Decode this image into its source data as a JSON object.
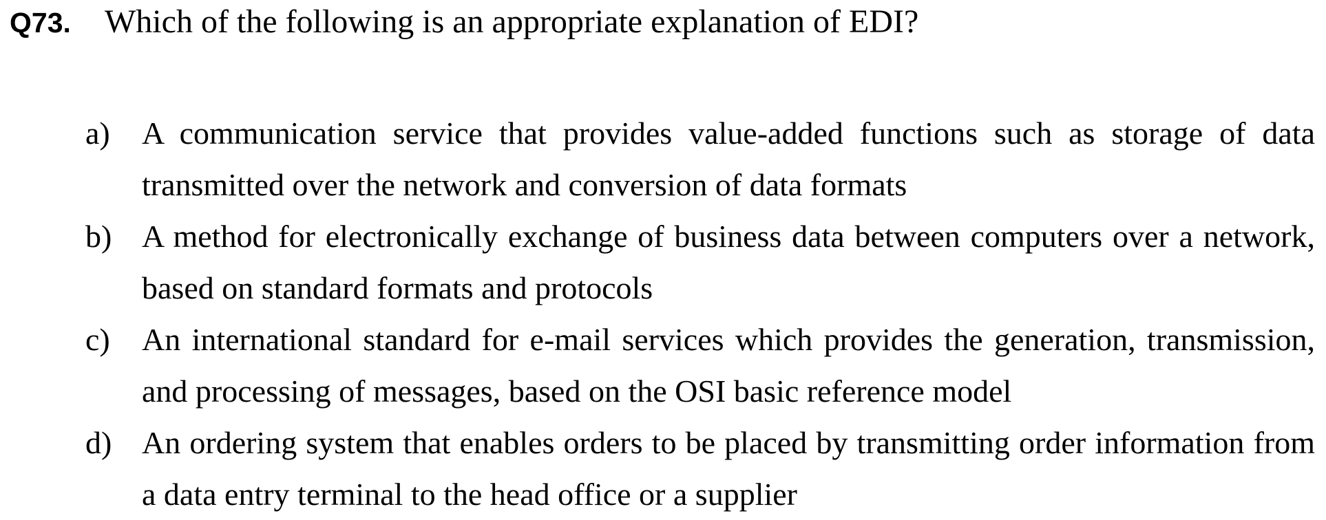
{
  "question": {
    "number": "Q73.",
    "text": "Which of the following is an appropriate explanation of EDI?"
  },
  "options": [
    {
      "letter": "a)",
      "text": "A communication service that provides value-added functions such as storage of data transmitted over the network and conversion of data formats"
    },
    {
      "letter": "b)",
      "text": "A method for electronically exchange of business data between computers over a network, based on standard formats and protocols"
    },
    {
      "letter": "c)",
      "text": "An international standard for e-mail services which provides the generation, transmission, and processing of messages, based on the OSI basic reference model"
    },
    {
      "letter": "d)",
      "text": "An ordering system that enables orders to be placed by transmitting order information from a data entry terminal to the head office or a supplier"
    }
  ]
}
